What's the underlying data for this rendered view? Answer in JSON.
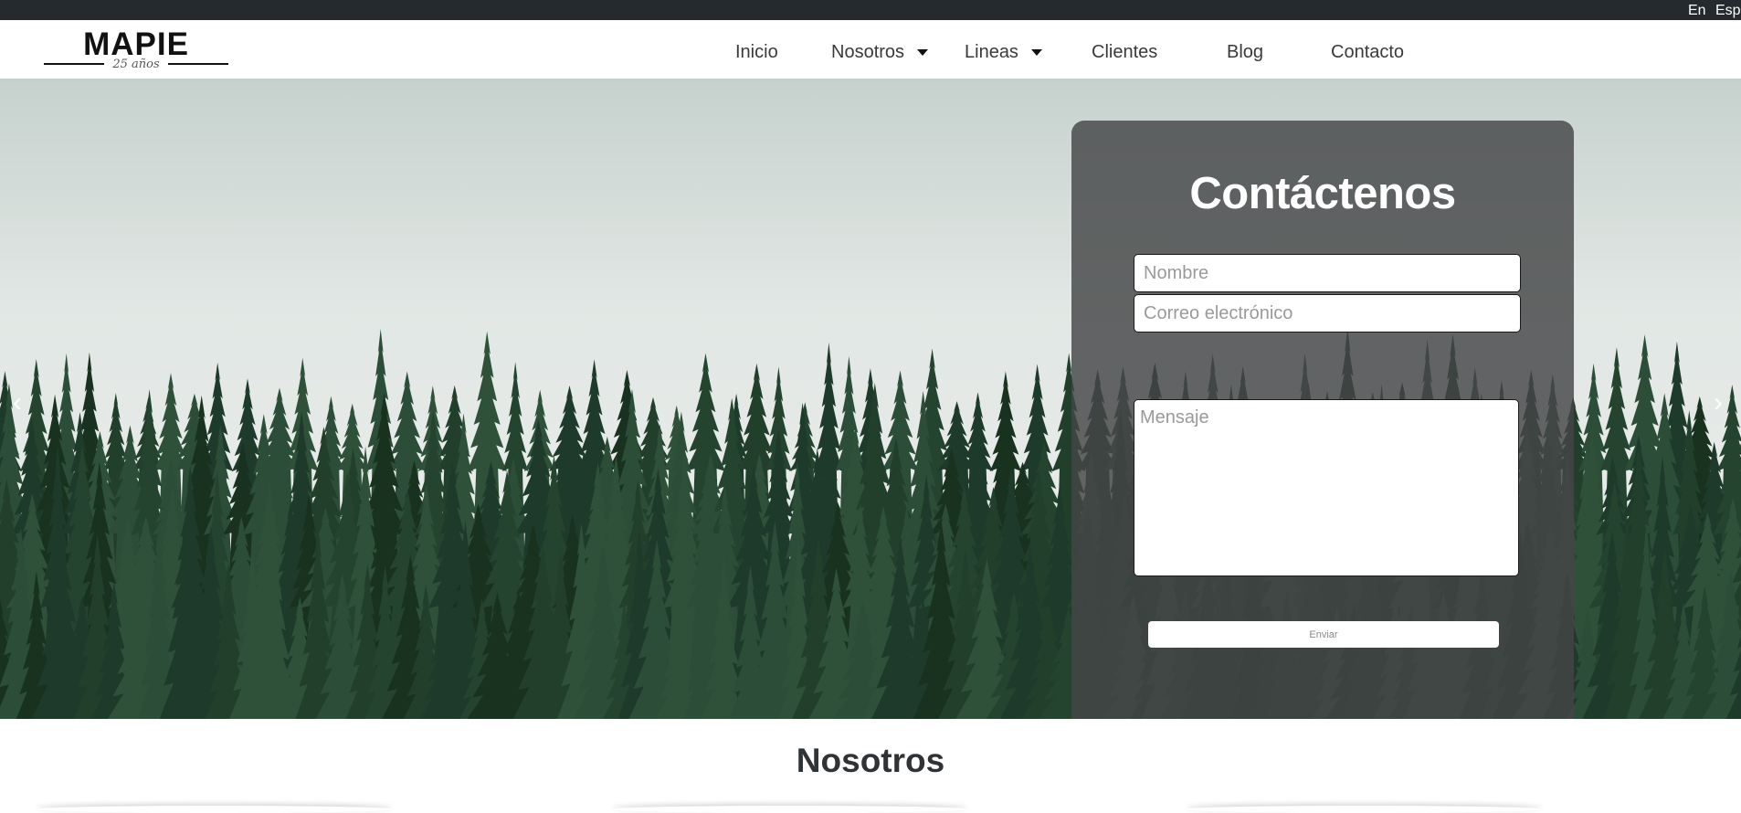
{
  "topbar": {
    "languages": [
      "En",
      "Esp"
    ]
  },
  "header": {
    "logo": {
      "brand": "MAPIE",
      "tagline": "25 años"
    },
    "nav": [
      {
        "label": "Inicio",
        "dropdown": false
      },
      {
        "label": "Nosotros",
        "dropdown": true
      },
      {
        "label": "Lineas",
        "dropdown": true
      },
      {
        "label": "Clientes",
        "dropdown": false
      },
      {
        "label": "Blog",
        "dropdown": false
      },
      {
        "label": "Contacto",
        "dropdown": false
      }
    ]
  },
  "hero": {
    "prev_icon": "chevron-left-icon",
    "next_icon": "chevron-right-icon",
    "prev_glyph": "‹",
    "next_glyph": "›"
  },
  "contact_form": {
    "title": "Contáctenos",
    "name_placeholder": "Nombre",
    "email_placeholder": "Correo electrónico",
    "message_placeholder": "Mensaje",
    "submit_label": "Enviar"
  },
  "section": {
    "title": "Nosotros"
  },
  "colors": {
    "topbar_bg": "#242a2d",
    "panel_bg": "#444647",
    "forest_dark": "#1f3a2c",
    "text_dark": "#2f3336"
  }
}
